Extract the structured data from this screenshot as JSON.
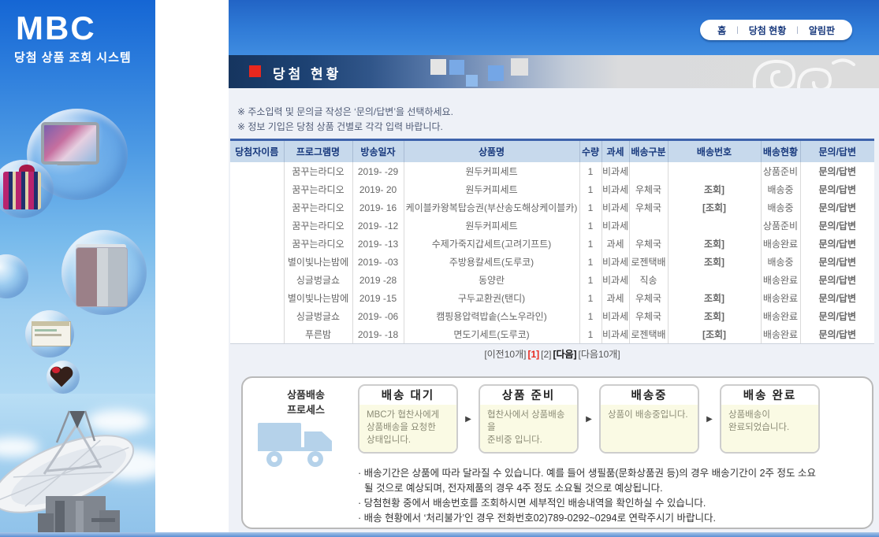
{
  "sidebar": {
    "logo": "MBC",
    "system_title": "당첨 상품 조회 시스템"
  },
  "topnav": {
    "separator": "|",
    "items": [
      {
        "label": "홈"
      },
      {
        "label": "당첨 현황"
      },
      {
        "label": "알림판"
      }
    ]
  },
  "banner": {
    "title": "당첨 현황"
  },
  "notices": [
    "※ 주소입력 및 문의글 작성은 ‘문의/답변’을 선택하세요.",
    "※ 정보 기입은 당첨 상품 건별로 각각 입력 바랍니다."
  ],
  "table": {
    "headers": [
      "당첨자이름",
      "프로그램명",
      "방송일자",
      "상품명",
      "수량",
      "과세",
      "배송구분",
      "배송번호",
      "배송현황",
      "문의/답변"
    ],
    "rows": [
      {
        "winner": "",
        "program": "꿈꾸는라디오",
        "date": "2019-   -29",
        "product": "원두커피세트",
        "qty": "1",
        "tax": "비과세",
        "carrier": "",
        "tracking": "",
        "status": "상품준비",
        "inquiry": "문의/답변"
      },
      {
        "winner": "",
        "program": "꿈꾸는라디오",
        "date": "2019-    20",
        "product": "원두커피세트",
        "qty": "1",
        "tax": "비과세",
        "carrier": "우체국",
        "tracking": "조회]",
        "status": "배송중",
        "inquiry": "문의/답변"
      },
      {
        "winner": "",
        "program": "꿈꾸는라디오",
        "date": "2019-    16",
        "product": "케이블카왕복탑승권(부산송도해상케이블카)",
        "qty": "1",
        "tax": "비과세",
        "carrier": "우체국",
        "tracking": "[조회]",
        "status": "배송중",
        "inquiry": "문의/답변"
      },
      {
        "winner": "",
        "program": "꿈꾸는라디오",
        "date": "2019-   -12",
        "product": "원두커피세트",
        "qty": "1",
        "tax": "비과세",
        "carrier": "",
        "tracking": "",
        "status": "상품준비",
        "inquiry": "문의/답변"
      },
      {
        "winner": "",
        "program": "꿈꾸는라디오",
        "date": "2019-   -13",
        "product": "수제가죽지갑세트(고려기프트)",
        "qty": "1",
        "tax": "과세",
        "carrier": "우체국",
        "tracking": "조회]",
        "status": "배송완료",
        "inquiry": "문의/답변"
      },
      {
        "winner": "",
        "program": "별이빛나는밤에",
        "date": "2019-   -03",
        "product": "주방용칼세트(도루코)",
        "qty": "1",
        "tax": "비과세",
        "carrier": "로젠택배",
        "tracking": "조회]",
        "status": "배송중",
        "inquiry": "문의/답변"
      },
      {
        "winner": "",
        "program": "싱글벙글쇼",
        "date": "2019    -28",
        "product": "동양란",
        "qty": "1",
        "tax": "비과세",
        "carrier": "직송",
        "tracking": "",
        "status": "배송완료",
        "inquiry": "문의/답변"
      },
      {
        "winner": "",
        "program": "별이빛나는밤에",
        "date": "2019    -15",
        "product": "구두교환권(탠디)",
        "qty": "1",
        "tax": "과세",
        "carrier": "우체국",
        "tracking": "조회]",
        "status": "배송완료",
        "inquiry": "문의/답변"
      },
      {
        "winner": "",
        "program": "싱글벙글쇼",
        "date": "2019-   -06",
        "product": "캠핑용압력밥솥(스노우라인)",
        "qty": "1",
        "tax": "비과세",
        "carrier": "우체국",
        "tracking": "조회]",
        "status": "배송완료",
        "inquiry": "문의/답변"
      },
      {
        "winner": "",
        "program": "푸른밤",
        "date": "2019-   -18",
        "product": "면도기세트(도루코)",
        "qty": "1",
        "tax": "비과세",
        "carrier": "로젠택배",
        "tracking": "[조회]",
        "status": "배송완료",
        "inquiry": "문의/답변"
      }
    ]
  },
  "pagination": {
    "items": [
      {
        "label": "[이전10개]",
        "style": "normal"
      },
      {
        "label": "[1]",
        "style": "current"
      },
      {
        "label": "[2]",
        "style": "normal"
      },
      {
        "label": "[다음]",
        "style": "bold"
      },
      {
        "label": "[다음10개]",
        "style": "normal"
      }
    ]
  },
  "process": {
    "label": "상품배송\n프로세스",
    "arrow": "▶",
    "steps": [
      {
        "title": "배송 대기",
        "desc": "MBC가 협찬사에게\n상품배송을 요청한\n상태입니다."
      },
      {
        "title": "상품 준비",
        "desc": "협찬사에서 상품배송을\n준비중 입니다."
      },
      {
        "title": "배송중",
        "desc": "상품이 배송중입니다."
      },
      {
        "title": "배송 완료",
        "desc": "상품배송이\n완료되었습니다."
      }
    ],
    "notes": [
      {
        "text": "· 배송기간은 상품에 따라 달라질 수 있습니다. 예를 들어 생필품(문화상품권 등)의 경우 배송기간이 2주 정도 소요",
        "indent": false
      },
      {
        "text": "될 것으로 예상되며, 전자제품의 경우 4주 정도 소요될 것으로 예상됩니다.",
        "indent": true
      },
      {
        "text": "· 당첨현황 중에서 배송번호를 조회하시면 세부적인 배송내역을 확인하실 수 있습니다.",
        "indent": false
      },
      {
        "text": "· 배송 현황에서 ‘처리불가’인 경우 전화번호02)789-0292~0294로 연락주시기 바랍니다.",
        "indent": false
      }
    ]
  },
  "colors": {
    "accent_red": "#e8281e",
    "topbar_blue": "#2f7ad6",
    "banner_navy": "#16355f",
    "table_header_bg": "#c7d9ec",
    "table_header_text": "#17387c",
    "step_body_bg": "#fafae4"
  }
}
